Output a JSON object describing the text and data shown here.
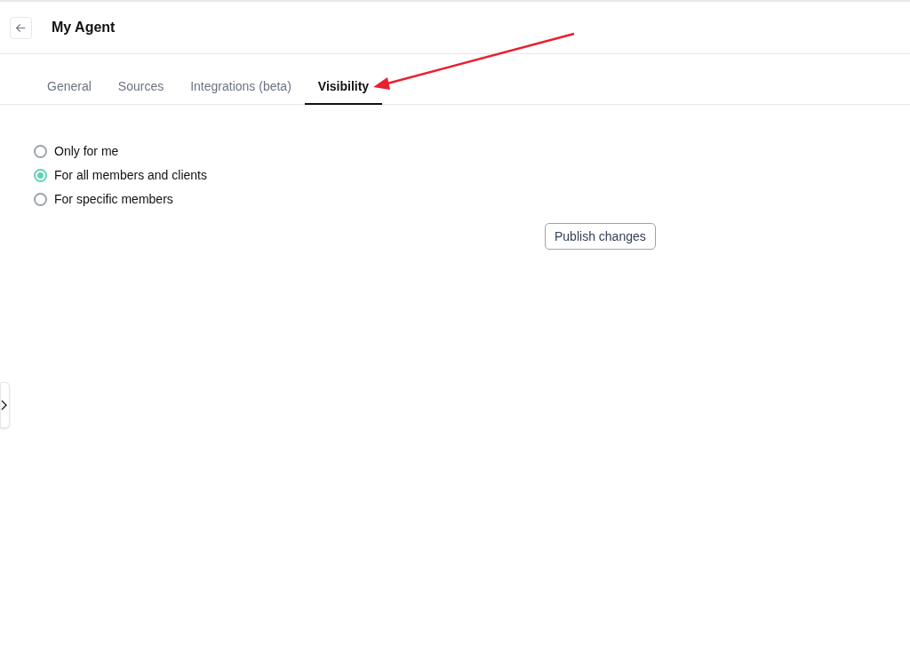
{
  "header": {
    "title": "My Agent"
  },
  "tabs": [
    {
      "label": "General",
      "selected": false
    },
    {
      "label": "Sources",
      "selected": false
    },
    {
      "label": "Integrations (beta)",
      "selected": false
    },
    {
      "label": "Visibility",
      "selected": true
    }
  ],
  "visibility_options": [
    {
      "label": "Only for me",
      "selected": false
    },
    {
      "label": "For all members and clients",
      "selected": true
    },
    {
      "label": "For specific members",
      "selected": false
    }
  ],
  "publish_button": "Publish changes"
}
